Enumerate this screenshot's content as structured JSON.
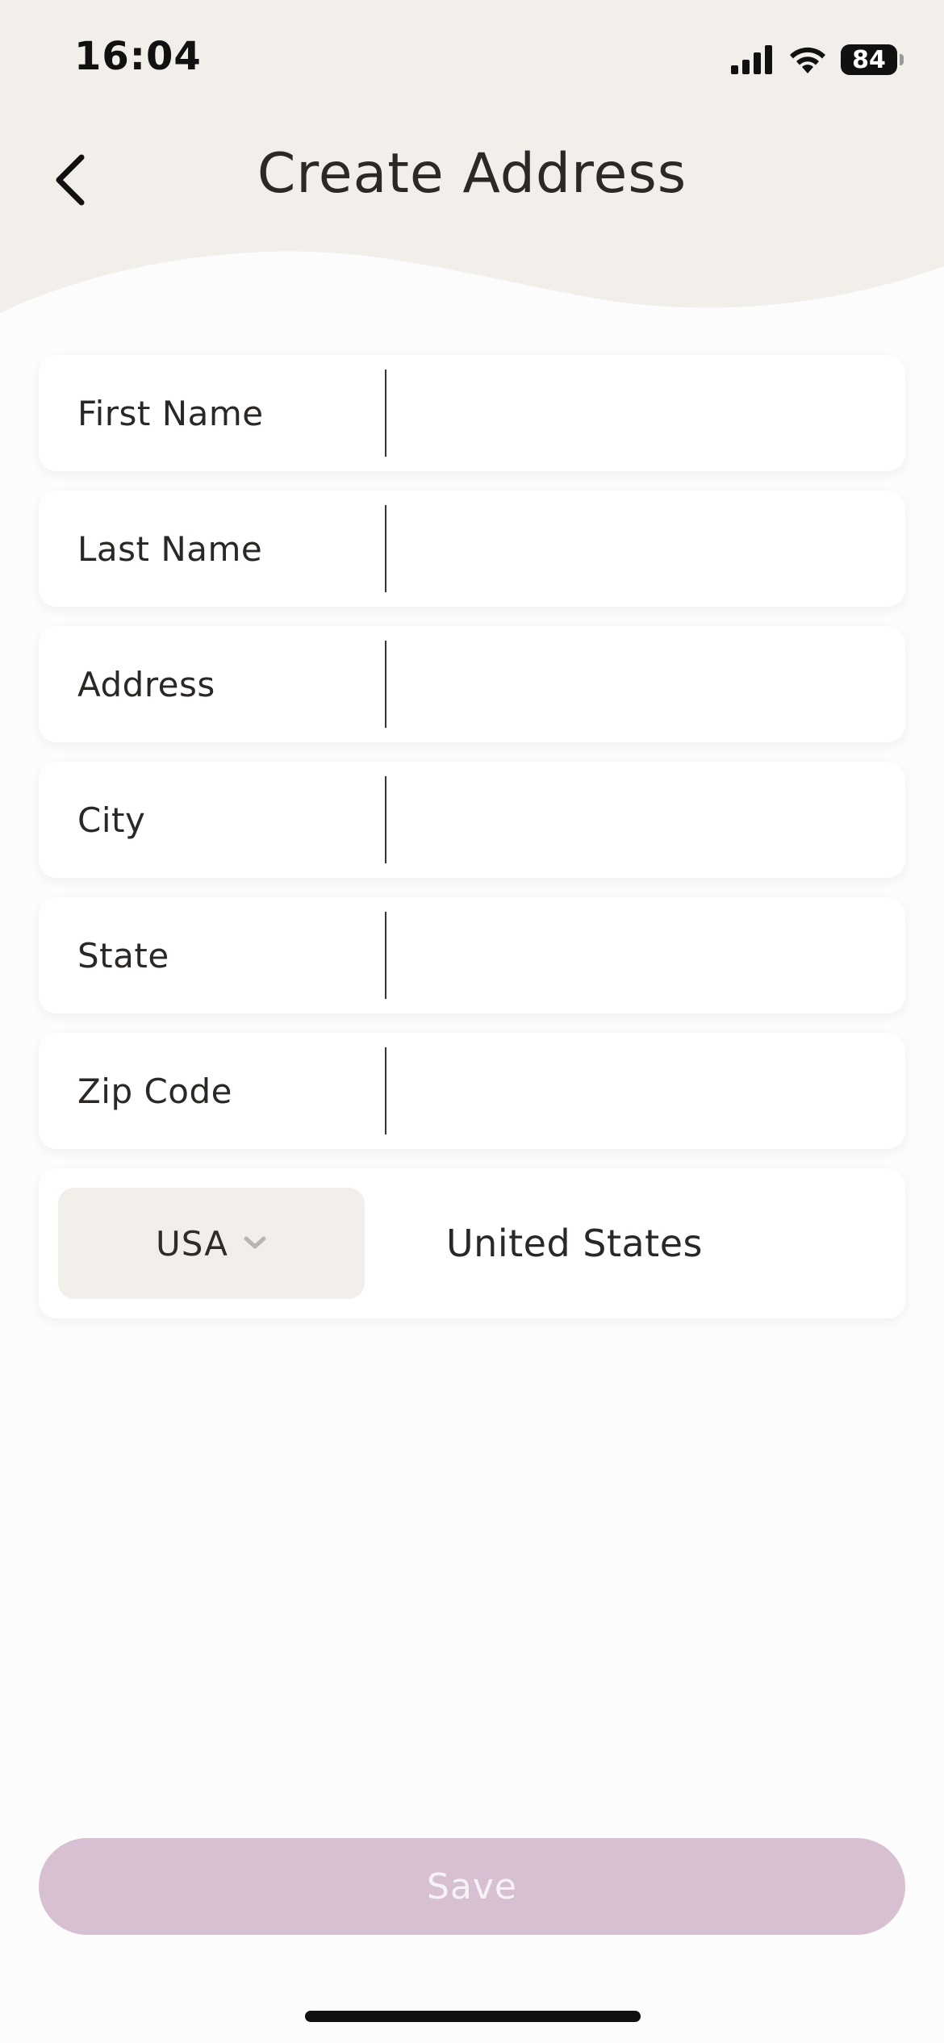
{
  "status_bar": {
    "time": "16:04",
    "battery": "84"
  },
  "header": {
    "title": "Create Address",
    "back_icon": "chevron-left-icon"
  },
  "form": {
    "fields": [
      {
        "label": "First Name",
        "value": "",
        "placeholder": ""
      },
      {
        "label": "Last Name",
        "value": "",
        "placeholder": ""
      },
      {
        "label": "Address",
        "value": "",
        "placeholder": ""
      },
      {
        "label": "City",
        "value": "",
        "placeholder": ""
      },
      {
        "label": "State",
        "value": "",
        "placeholder": ""
      },
      {
        "label": "Zip Code",
        "value": "",
        "placeholder": ""
      }
    ],
    "country": {
      "code": "USA",
      "name": "United States",
      "dropdown_icon": "chevron-down-icon"
    }
  },
  "actions": {
    "save_label": "Save"
  },
  "colors": {
    "header_bg": "#f2eeea",
    "page_bg": "#fcfcfc",
    "save_button": "#d6c0d2",
    "country_chip": "#f2eeea"
  }
}
